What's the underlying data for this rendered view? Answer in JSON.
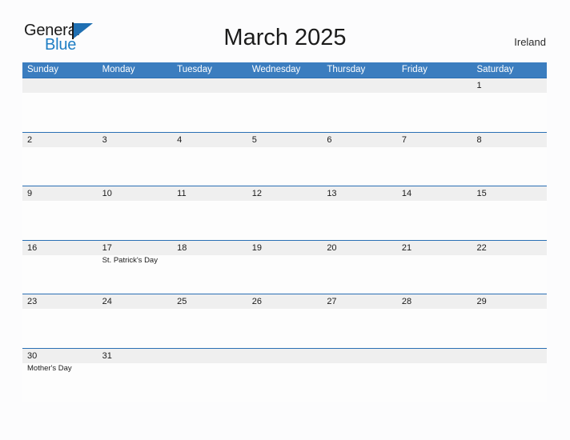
{
  "brand": {
    "name_part1": "General",
    "name_part2": "Blue",
    "flag_icon": "flag-triangle-icon",
    "colors": {
      "black": "#1b1b1b",
      "blue": "#1f7ec4",
      "flag_blue": "#1f6fb2"
    }
  },
  "header": {
    "title": "March 2025",
    "country": "Ireland"
  },
  "theme": {
    "header_blue": "#3b7dbf",
    "rule_blue": "#2a6fb4",
    "daynum_band": "#efefef",
    "cell_bg": "#fdfdfd",
    "page_bg": "#fcfcfd"
  },
  "calendar": {
    "month": "March",
    "year": "2025",
    "day_headers": [
      "Sunday",
      "Monday",
      "Tuesday",
      "Wednesday",
      "Thursday",
      "Friday",
      "Saturday"
    ],
    "weeks": [
      {
        "days": [
          {
            "num": "",
            "event": ""
          },
          {
            "num": "",
            "event": ""
          },
          {
            "num": "",
            "event": ""
          },
          {
            "num": "",
            "event": ""
          },
          {
            "num": "",
            "event": ""
          },
          {
            "num": "",
            "event": ""
          },
          {
            "num": "1",
            "event": ""
          }
        ]
      },
      {
        "days": [
          {
            "num": "2",
            "event": ""
          },
          {
            "num": "3",
            "event": ""
          },
          {
            "num": "4",
            "event": ""
          },
          {
            "num": "5",
            "event": ""
          },
          {
            "num": "6",
            "event": ""
          },
          {
            "num": "7",
            "event": ""
          },
          {
            "num": "8",
            "event": ""
          }
        ]
      },
      {
        "days": [
          {
            "num": "9",
            "event": ""
          },
          {
            "num": "10",
            "event": ""
          },
          {
            "num": "11",
            "event": ""
          },
          {
            "num": "12",
            "event": ""
          },
          {
            "num": "13",
            "event": ""
          },
          {
            "num": "14",
            "event": ""
          },
          {
            "num": "15",
            "event": ""
          }
        ]
      },
      {
        "days": [
          {
            "num": "16",
            "event": ""
          },
          {
            "num": "17",
            "event": "St. Patrick's Day"
          },
          {
            "num": "18",
            "event": ""
          },
          {
            "num": "19",
            "event": ""
          },
          {
            "num": "20",
            "event": ""
          },
          {
            "num": "21",
            "event": ""
          },
          {
            "num": "22",
            "event": ""
          }
        ]
      },
      {
        "days": [
          {
            "num": "23",
            "event": ""
          },
          {
            "num": "24",
            "event": ""
          },
          {
            "num": "25",
            "event": ""
          },
          {
            "num": "26",
            "event": ""
          },
          {
            "num": "27",
            "event": ""
          },
          {
            "num": "28",
            "event": ""
          },
          {
            "num": "29",
            "event": ""
          }
        ]
      },
      {
        "days": [
          {
            "num": "30",
            "event": "Mother's Day"
          },
          {
            "num": "31",
            "event": ""
          },
          {
            "num": "",
            "event": ""
          },
          {
            "num": "",
            "event": ""
          },
          {
            "num": "",
            "event": ""
          },
          {
            "num": "",
            "event": ""
          },
          {
            "num": "",
            "event": ""
          }
        ]
      }
    ]
  }
}
